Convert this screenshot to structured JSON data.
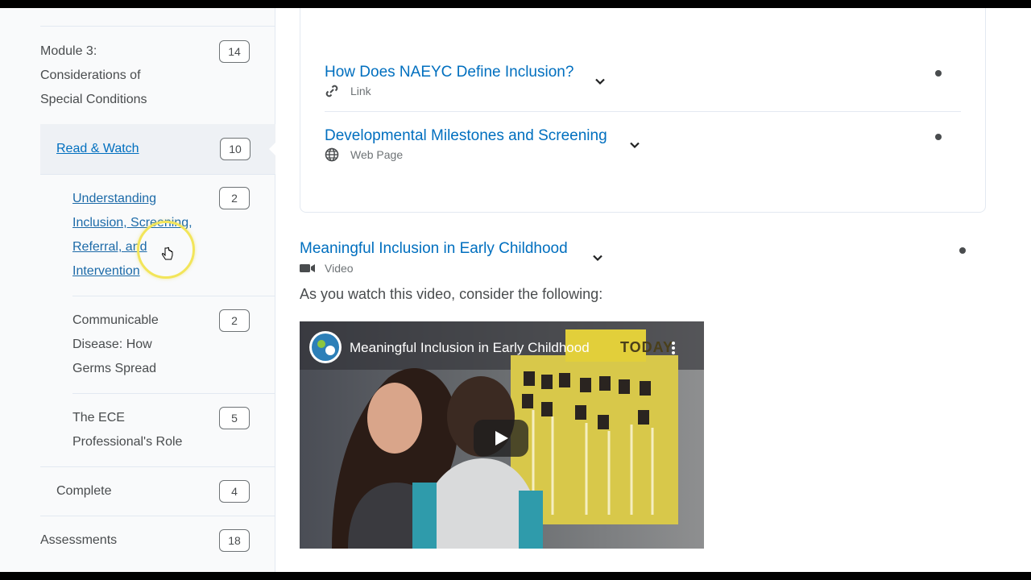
{
  "sidebar": {
    "module": {
      "label_lines": [
        "Module 3:",
        "Considerations of",
        "Special Conditions"
      ],
      "count": "14"
    },
    "read_watch": {
      "label": "Read & Watch",
      "count": "10"
    },
    "topics": [
      {
        "label_lines": [
          "Understanding",
          "Inclusion, Screening,",
          "Referral, and",
          "Intervention"
        ],
        "count": "2"
      },
      {
        "label_lines": [
          "Communicable",
          "Disease: How",
          "Germs Spread"
        ],
        "count": "2"
      },
      {
        "label_lines": [
          "The ECE",
          "Professional's Role"
        ],
        "count": "5"
      }
    ],
    "complete": {
      "label": "Complete",
      "count": "4"
    },
    "assessments": {
      "label": "Assessments",
      "count": "18"
    }
  },
  "content": {
    "items": [
      {
        "title": "How Does NAEYC Define Inclusion?",
        "type": "Link",
        "icon": "link-icon"
      },
      {
        "title": "Developmental Milestones and Screening",
        "type": "Web Page",
        "icon": "globe-icon"
      }
    ],
    "video_item": {
      "title": "Meaningful Inclusion in Early Childhood",
      "type": "Video",
      "icon": "video-camera-icon",
      "description": "As you watch this video, consider the following:"
    },
    "video_player": {
      "title": "Meaningful Inclusion in Early Childhood",
      "banner": "TODAY"
    }
  },
  "colors": {
    "link": "#006fbf",
    "text": "#494c4e",
    "border": "#e3e9f1",
    "highlight": "#f2e55a"
  }
}
